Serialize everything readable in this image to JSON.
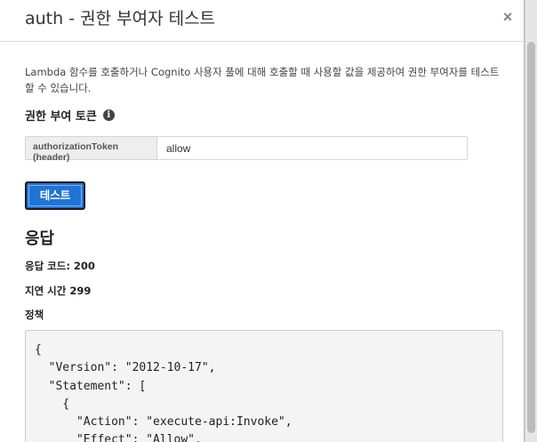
{
  "dialog": {
    "title": "auth - 권한 부여자 테스트",
    "close_label": "×",
    "description": "Lambda 함수를 호출하거나 Cognito 사용자 풀에 대해 호출할 때 사용할 값을 제공하여 권한 부여자를 테스트할 수 있습니다.",
    "token_section_label": "권한 부여 토큰",
    "info_icon_glyph": "i",
    "token_field": {
      "label": "authorizationToken (header)",
      "value": "allow"
    },
    "test_button_label": "테스트"
  },
  "response": {
    "title": "응답",
    "code_line": "응답 코드: 200",
    "latency_line": "지연 시간 299",
    "policy_label": "정책",
    "policy_json": "{\n  \"Version\": \"2012-10-17\",\n  \"Statement\": [\n    {\n      \"Action\": \"execute-api:Invoke\",\n      \"Effect\": \"Allow\","
  }
}
